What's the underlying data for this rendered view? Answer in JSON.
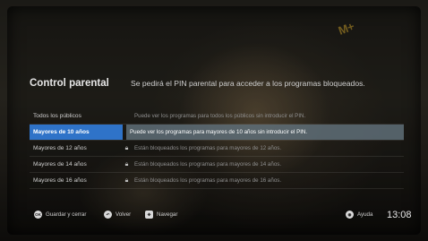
{
  "header": {
    "title": "Control parental",
    "subtitle": "Se pedirá el PIN parental para acceder a los programas bloqueados.",
    "channel_logo": "M+"
  },
  "options": [
    {
      "label": "Todos los públicos",
      "desc": "Puede ver los programas para todos los públicos sin introducir el PIN.",
      "locked": false,
      "selected": false
    },
    {
      "label": "Mayores de 10 años",
      "desc": "Puede ver los programas para mayores de 10 años sin introducir el PIN.",
      "locked": false,
      "selected": true
    },
    {
      "label": "Mayores de 12 años",
      "desc": "Están bloqueados los programas para mayores de 12 años.",
      "locked": true,
      "selected": false
    },
    {
      "label": "Mayores de 14 años",
      "desc": "Están bloqueados los programas para mayores de 14 años.",
      "locked": true,
      "selected": false
    },
    {
      "label": "Mayores de 16 años",
      "desc": "Están bloqueados los programas para mayores de 16 años.",
      "locked": true,
      "selected": false
    }
  ],
  "footer": {
    "ok_icon": "OK",
    "ok_label": "Guardar y cerrar",
    "back_label": "Volver",
    "nav_label": "Navegar",
    "help_label": "Ayuda",
    "time": "13:08"
  },
  "colors": {
    "selected_bg": "#2f73c8",
    "selected_desc_bg": "#5f6e78"
  }
}
